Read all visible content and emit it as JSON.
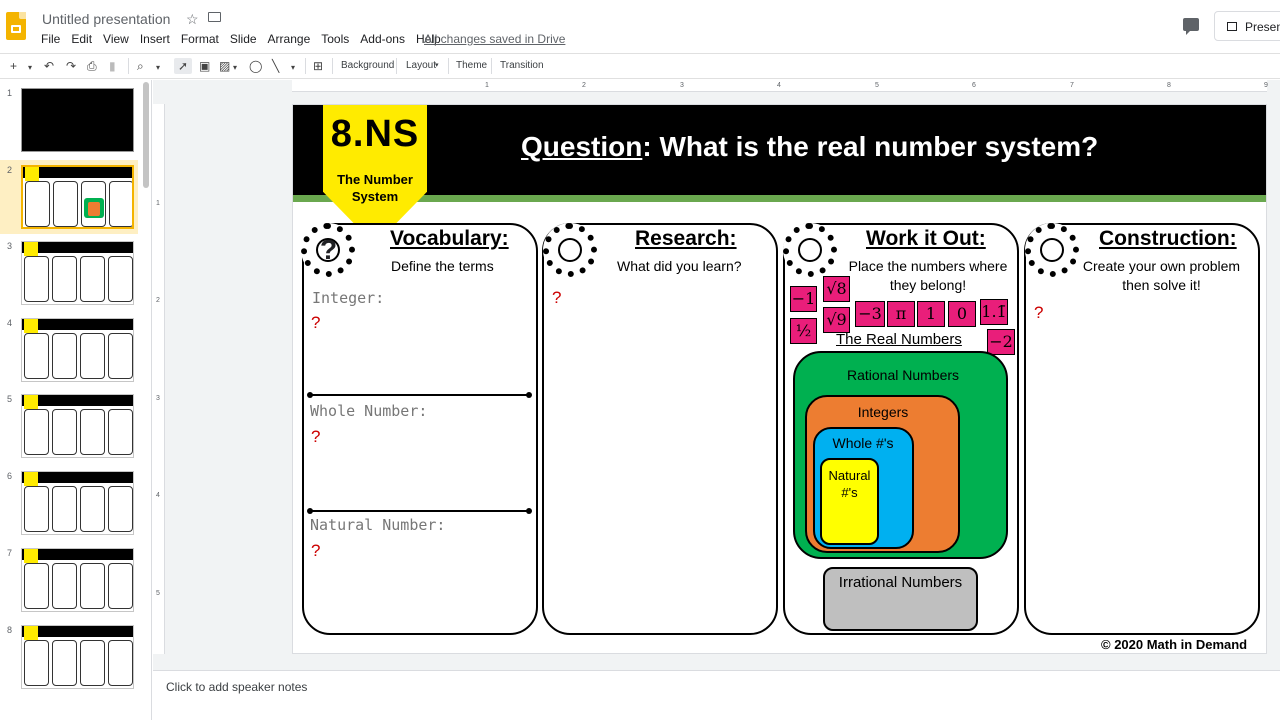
{
  "app": {
    "doc_title": "Untitled presentation",
    "menu": [
      "File",
      "Edit",
      "View",
      "Insert",
      "Format",
      "Slide",
      "Arrange",
      "Tools",
      "Add-ons",
      "Help"
    ],
    "save_status": "All changes saved in Drive",
    "present_label": "Presen"
  },
  "toolbar": {
    "background": "Background",
    "layout": "Layout",
    "theme": "Theme",
    "transition": "Transition"
  },
  "filmstrip": {
    "numbers": [
      "1",
      "2",
      "3",
      "4",
      "5",
      "6",
      "7",
      "8"
    ],
    "selected": 2
  },
  "ruler": {
    "top": [
      "1",
      "2",
      "3",
      "4",
      "5",
      "6",
      "7",
      "8",
      "9"
    ],
    "left": [
      "1",
      "2",
      "3",
      "4",
      "5"
    ]
  },
  "slide": {
    "badge_main": "8.NS",
    "badge_sub": "The Number System",
    "question_label": "Question",
    "question_text": ": What is the real number system?",
    "cards": [
      {
        "title": "Vocabulary:",
        "subtitle": "Define the terms"
      },
      {
        "title": "Research:",
        "subtitle": "What did you learn?"
      },
      {
        "title": "Work it Out:",
        "subtitle": "Place the numbers where they belong!"
      },
      {
        "title": "Construction:",
        "subtitle": "Create your own problem then solve it!"
      }
    ],
    "vocab_terms": [
      "Integer:",
      "Whole Number:",
      "Natural Number:"
    ],
    "placeholder_mark": "?",
    "number_chips": [
      "−1",
      "√8",
      "−3",
      "π",
      "1",
      "0",
      "1.1̄",
      "½",
      "√9",
      "−2"
    ],
    "real_numbers_label": "The Real Numbers",
    "rational_label": "Rational Numbers",
    "integers_label": "Integers",
    "whole_label": "Whole #'s",
    "natural_label": "Natural #'s",
    "irrational_label": "Irrational Numbers",
    "copyright": "© 2020 Math in Demand"
  },
  "notes_placeholder": "Click to add speaker notes",
  "colors": {
    "yellow": "#ffeb00",
    "green_bar": "#6aa84f",
    "chip": "#e91e7a",
    "rational": "#00b050",
    "integers": "#ed7d31",
    "whole": "#00b0f0",
    "natural": "#ffff00",
    "irrational": "#bfbfbf",
    "selection": "#feefc3"
  },
  "icons": [
    "slides-logo-icon",
    "star-icon",
    "move-folder-icon",
    "comment-icon",
    "present-icon",
    "plus-icon",
    "undo-icon",
    "redo-icon",
    "print-icon",
    "paint-format-icon",
    "zoom-icon",
    "select-icon",
    "textbox-icon",
    "image-icon",
    "shape-icon",
    "line-icon",
    "add-comment-icon",
    "question-gear-icon",
    "book-gear-icon",
    "pencil-gear-icon",
    "tools-gear-icon"
  ]
}
